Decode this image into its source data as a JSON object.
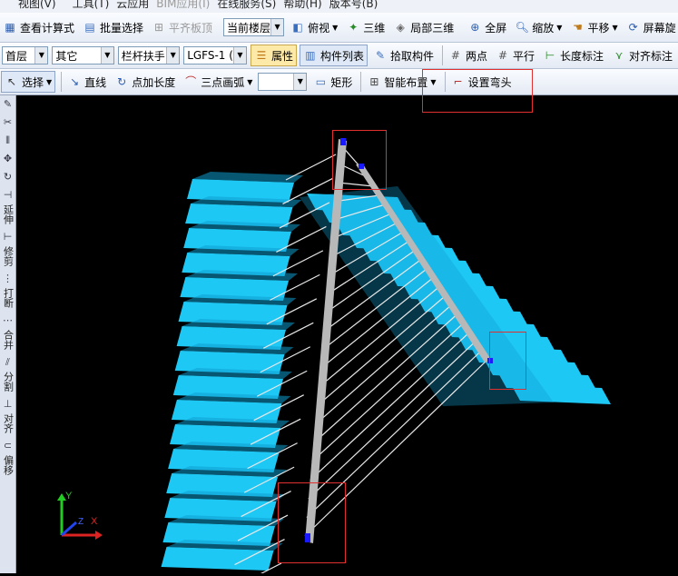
{
  "menubar": {
    "items": [
      "视图(V)",
      "工具(T)",
      "云应用",
      "BIM应用(I)",
      "在线服务(S)",
      "帮助(H)",
      "版本号(B)"
    ]
  },
  "toolbar1": {
    "view_formula": "查看计算式",
    "batch_select": "批量选择",
    "align_slab_top": "平齐板顶",
    "floor_select": "当前楼层",
    "top_view": "俯视",
    "three_d": "三维",
    "partial_3d": "局部三维",
    "full_screen": "全屏",
    "zoom": "缩放",
    "pan": "平移",
    "screen_rotate": "屏幕旋"
  },
  "toolbar2": {
    "floor": "首层",
    "category": "其它",
    "component_type": "栏杆扶手",
    "component": "LGFS-1 (",
    "properties": "属性",
    "component_list": "构件列表",
    "pick_component": "拾取构件",
    "two_points": "两点",
    "parallel": "平行",
    "length_dim": "长度标注",
    "align_dim": "对齐标注"
  },
  "toolbar3": {
    "select": "选择",
    "line": "直线",
    "point_length": "点加长度",
    "three_point_arc": "三点画弧",
    "arc_option": "",
    "rectangle": "矩形",
    "smart_layout": "智能布置",
    "set_elbow": "设置弯头"
  },
  "left_toolbar": {
    "extend": "延伸",
    "trim": "修剪",
    "break": "打断",
    "merge": "合并",
    "split": "分割",
    "align": "对齐",
    "offset": "偏移"
  },
  "axis": {
    "x": "X",
    "y": "Y",
    "z": "Z"
  },
  "colors": {
    "stair": "#1ec8f5",
    "stair_shadow": "#0f9fd0",
    "rail": "#b8b8b8",
    "baluster": "#e8e8e8",
    "highlight": "#e03030",
    "endpoint": "#1a1aff"
  }
}
